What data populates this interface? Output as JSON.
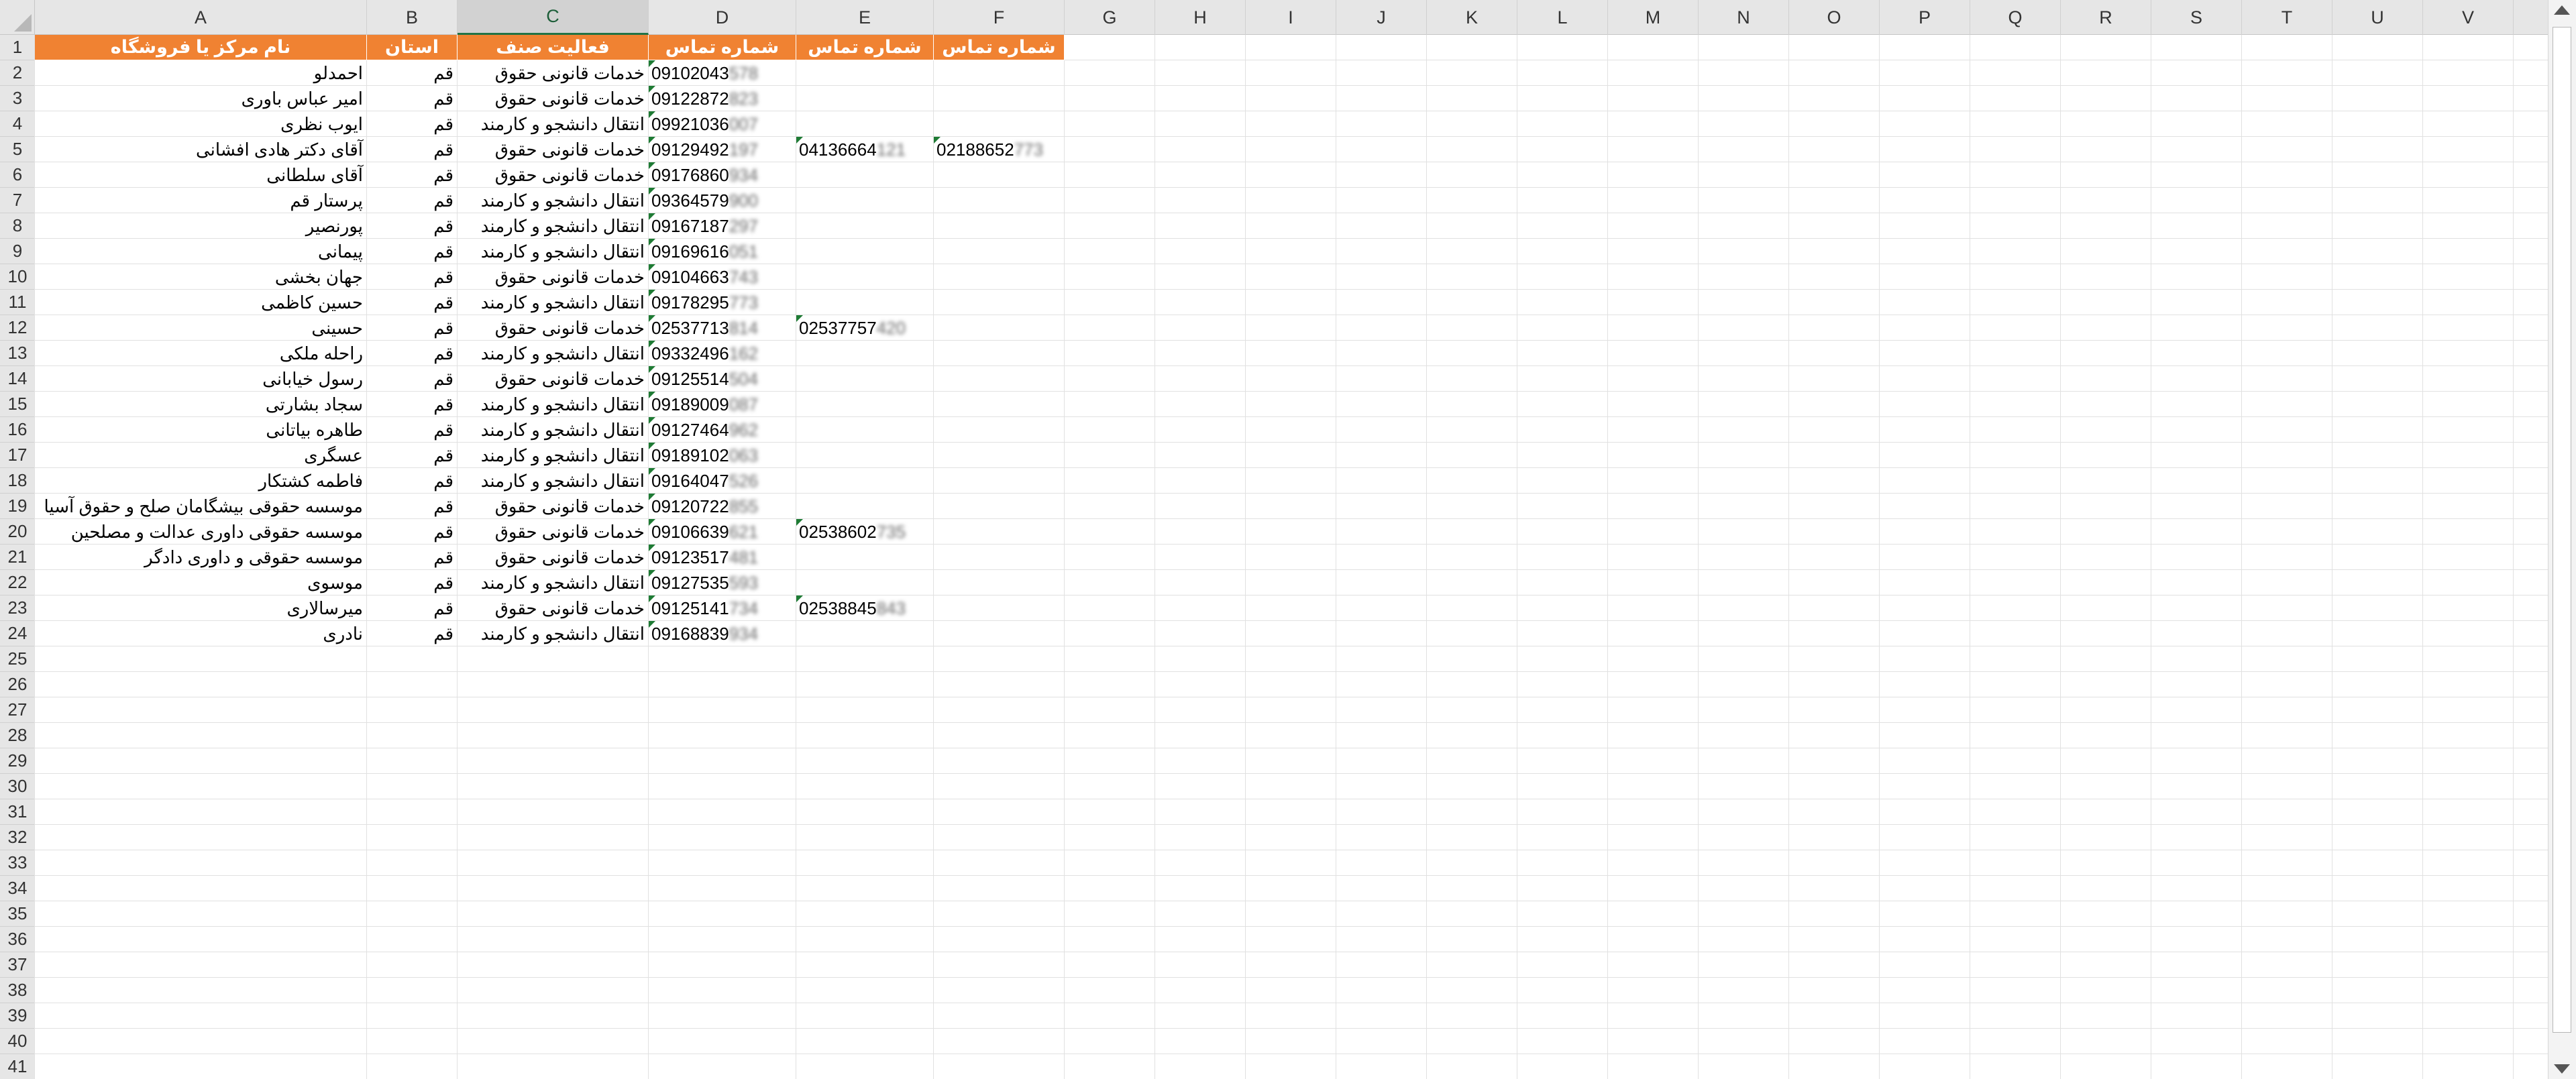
{
  "spreadsheet": {
    "columns": [
      "A",
      "B",
      "C",
      "D",
      "E",
      "F",
      "G",
      "H",
      "I",
      "J",
      "K",
      "L",
      "M",
      "N",
      "O",
      "P",
      "Q",
      "R",
      "S",
      "T",
      "U",
      "V"
    ],
    "selected_column": "C",
    "row_numbers": [
      "1",
      "2",
      "3",
      "4",
      "5",
      "6",
      "7",
      "8",
      "9",
      "10",
      "11",
      "12",
      "13",
      "14",
      "15",
      "16",
      "17",
      "18",
      "19",
      "20",
      "21",
      "22",
      "23",
      "24",
      "25",
      "26",
      "27",
      "28",
      "29",
      "30",
      "31",
      "32",
      "33",
      "34",
      "35",
      "36",
      "37",
      "38",
      "39",
      "40",
      "41"
    ],
    "header_row": {
      "A": "نام مرکز یا فروشگاه",
      "B": "استان",
      "C": "فعالیت صنف",
      "D": "شماره تماس",
      "E": "شماره تماس",
      "F": "شماره تماس"
    },
    "colors": {
      "header_fill": "#f08232",
      "header_text": "#ffffff",
      "selected_column": "#217346",
      "error_marker": "#1e7b34"
    },
    "rows": [
      {
        "name": "احمدلو",
        "province": "قم",
        "activity": "خدمات قانونی حقوق",
        "phone1": {
          "visible": "09102043",
          "hidden": "578"
        }
      },
      {
        "name": "امیر عباس باوری",
        "province": "قم",
        "activity": "خدمات قانونی حقوق",
        "phone1": {
          "visible": "09122872",
          "hidden": "823"
        }
      },
      {
        "name": "ایوب نظری",
        "province": "قم",
        "activity": "انتقال دانشجو و کارمند",
        "phone1": {
          "visible": "09921036",
          "hidden": "007"
        }
      },
      {
        "name": "آقای دکتر هادی افشانی",
        "province": "قم",
        "activity": "خدمات قانونی حقوق",
        "phone1": {
          "visible": "09129492",
          "hidden": "197"
        },
        "phone2": {
          "visible": "04136664",
          "hidden": "121"
        },
        "phone3": {
          "visible": "02188652",
          "hidden": "773"
        }
      },
      {
        "name": "آقای سلطانی",
        "province": "قم",
        "activity": "خدمات قانونی حقوق",
        "phone1": {
          "visible": "09176860",
          "hidden": "934"
        }
      },
      {
        "name": "پرستار قم",
        "province": "قم",
        "activity": "انتقال دانشجو و کارمند",
        "phone1": {
          "visible": "09364579",
          "hidden": "900"
        }
      },
      {
        "name": "پورنصیر",
        "province": "قم",
        "activity": "انتقال دانشجو و کارمند",
        "phone1": {
          "visible": "09167187",
          "hidden": "297"
        }
      },
      {
        "name": "پیمانی",
        "province": "قم",
        "activity": "انتقال دانشجو و کارمند",
        "phone1": {
          "visible": "09169616",
          "hidden": "051"
        }
      },
      {
        "name": "جهان بخشی",
        "province": "قم",
        "activity": "خدمات قانونی حقوق",
        "phone1": {
          "visible": "09104663",
          "hidden": "743"
        }
      },
      {
        "name": "حسین کاظمی",
        "province": "قم",
        "activity": "انتقال دانشجو و کارمند",
        "phone1": {
          "visible": "09178295",
          "hidden": "773"
        }
      },
      {
        "name": "حسینی",
        "province": "قم",
        "activity": "خدمات قانونی حقوق",
        "phone1": {
          "visible": "02537713",
          "hidden": "814"
        },
        "phone2": {
          "visible": "02537757",
          "hidden": "420"
        }
      },
      {
        "name": "راحله ملکی",
        "province": "قم",
        "activity": "انتقال دانشجو و کارمند",
        "phone1": {
          "visible": "09332496",
          "hidden": "162"
        }
      },
      {
        "name": "رسول خیابانی",
        "province": "قم",
        "activity": "خدمات قانونی حقوق",
        "phone1": {
          "visible": "09125514",
          "hidden": "504"
        }
      },
      {
        "name": "سجاد بشارتی",
        "province": "قم",
        "activity": "انتقال دانشجو و کارمند",
        "phone1": {
          "visible": "09189009",
          "hidden": "087"
        }
      },
      {
        "name": "طاهره بیاتانی",
        "province": "قم",
        "activity": "انتقال دانشجو و کارمند",
        "phone1": {
          "visible": "09127464",
          "hidden": "962"
        }
      },
      {
        "name": "عسگری",
        "province": "قم",
        "activity": "انتقال دانشجو و کارمند",
        "phone1": {
          "visible": "09189102",
          "hidden": "063"
        }
      },
      {
        "name": "فاطمه کشتکار",
        "province": "قم",
        "activity": "انتقال دانشجو و کارمند",
        "phone1": {
          "visible": "09164047",
          "hidden": "526"
        }
      },
      {
        "name": "موسسه حقوقی بیشگامان صلح و حقوق آسیا",
        "province": "قم",
        "activity": "خدمات قانونی حقوق",
        "phone1": {
          "visible": "09120722",
          "hidden": "855"
        }
      },
      {
        "name": "موسسه حقوقی داوری عدالت و مصلحین",
        "province": "قم",
        "activity": "خدمات قانونی حقوق",
        "phone1": {
          "visible": "09106639",
          "hidden": "621"
        },
        "phone2": {
          "visible": "02538602",
          "hidden": "735"
        }
      },
      {
        "name": "موسسه حقوقی و داوری دادگر",
        "province": "قم",
        "activity": "خدمات قانونی حقوق",
        "phone1": {
          "visible": "09123517",
          "hidden": "481"
        }
      },
      {
        "name": "موسوی",
        "province": "قم",
        "activity": "انتقال دانشجو و کارمند",
        "phone1": {
          "visible": "09127535",
          "hidden": "593"
        }
      },
      {
        "name": "میرسالاری",
        "province": "قم",
        "activity": "خدمات قانونی حقوق",
        "phone1": {
          "visible": "09125141",
          "hidden": "734"
        },
        "phone2": {
          "visible": "02538845",
          "hidden": "843"
        }
      },
      {
        "name": "نادری",
        "province": "قم",
        "activity": "انتقال دانشجو و کارمند",
        "phone1": {
          "visible": "09168839",
          "hidden": "934"
        }
      }
    ]
  }
}
